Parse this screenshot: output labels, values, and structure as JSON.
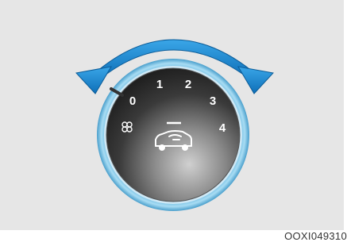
{
  "dial": {
    "positions": [
      "0",
      "1",
      "2",
      "3",
      "4"
    ],
    "fan_icon": "fan-icon",
    "mode_icon": "car-windshield-airflow-icon",
    "direction": "rotate-both-ways"
  },
  "colors": {
    "background": "#e6e6e6",
    "arrow": "#1a8ad4",
    "ring": "#7cc6e8",
    "knob_dark": "#2b2b2b",
    "knob_light": "#bfbfbf"
  },
  "figure_code": "OOXI049310"
}
